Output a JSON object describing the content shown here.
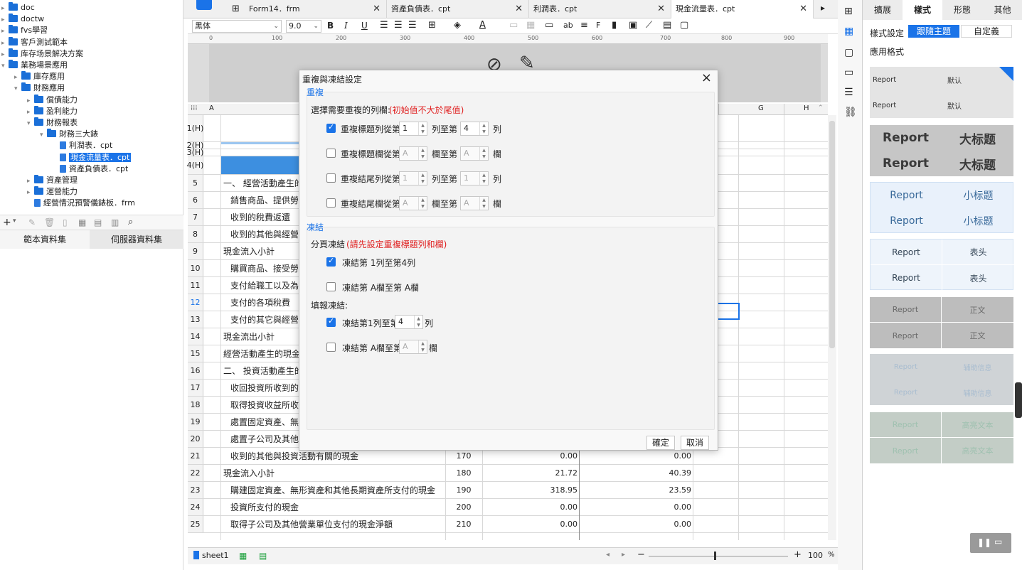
{
  "tree": [
    {
      "label": "doc",
      "type": "folder",
      "level": 0,
      "arrow": "▸"
    },
    {
      "label": "doctw",
      "type": "folder",
      "level": 0,
      "arrow": "▸"
    },
    {
      "label": "fvs學習",
      "type": "folder",
      "level": 0,
      "arrow": "▸"
    },
    {
      "label": "客戶測試範本",
      "type": "folder",
      "level": 0,
      "arrow": "▸"
    },
    {
      "label": "库存场景解决方案",
      "type": "folder",
      "level": 0,
      "arrow": "▸"
    },
    {
      "label": "業務場景應用",
      "type": "folder",
      "level": 0,
      "arrow": "▾"
    },
    {
      "label": "庫存應用",
      "type": "folder",
      "level": 1,
      "arrow": "▸"
    },
    {
      "label": "財務應用",
      "type": "folder",
      "level": 1,
      "arrow": "▾"
    },
    {
      "label": "償債能力",
      "type": "folder",
      "level": 2,
      "arrow": "▸"
    },
    {
      "label": "盈利能力",
      "type": "folder",
      "level": 2,
      "arrow": "▸"
    },
    {
      "label": "財務報表",
      "type": "folder",
      "level": 2,
      "arrow": "▾"
    },
    {
      "label": "財務三大錶",
      "type": "folder",
      "level": 3,
      "arrow": "▾"
    },
    {
      "label": "利潤表．cpt",
      "type": "file",
      "level": 4,
      "arrow": ""
    },
    {
      "label": "現金流量表．cpt",
      "type": "file",
      "level": 4,
      "arrow": "",
      "selected": true
    },
    {
      "label": "資產負債表．cpt",
      "type": "file",
      "level": 4,
      "arrow": ""
    },
    {
      "label": "資產管理",
      "type": "folder",
      "level": 2,
      "arrow": "▸"
    },
    {
      "label": "運營能力",
      "type": "folder",
      "level": 2,
      "arrow": "▸"
    },
    {
      "label": "經營情況預警儀錶板．frm",
      "type": "file",
      "level": 2,
      "arrow": ""
    }
  ],
  "left_tabs": {
    "template_ds": "範本資料集",
    "server_ds": "伺服器資料集"
  },
  "doc_tabs": [
    {
      "label": "Form14．frm"
    },
    {
      "label": "資產負債表．cpt"
    },
    {
      "label": "利潤表．cpt"
    },
    {
      "label": "現金流量表．cpt"
    }
  ],
  "format": {
    "font": "黑体",
    "size": "9.0"
  },
  "ruler": [
    "0",
    "100",
    "200",
    "300",
    "400",
    "500",
    "600",
    "700",
    "800",
    "900"
  ],
  "columns": [
    "A",
    "G",
    "H"
  ],
  "rows": [
    {
      "n": "1(H)",
      "a": "",
      "b": "",
      "c": "",
      "d": ""
    },
    {
      "n": "2(H)",
      "a": "",
      "b": "",
      "c": "",
      "d": ""
    },
    {
      "n": "3(H)",
      "a": "",
      "b": "",
      "c": "",
      "d": ""
    },
    {
      "n": "4(H)",
      "a": "",
      "b": "",
      "c": "",
      "d": ""
    },
    {
      "n": "5",
      "a": "一、 經營活動產生的",
      "b": "",
      "c": "",
      "d": ""
    },
    {
      "n": "6",
      "a": "  銷售商品、提供勞務",
      "b": "",
      "c": "",
      "d": ""
    },
    {
      "n": "7",
      "a": "  收到的稅費返還",
      "b": "",
      "c": "",
      "d": ""
    },
    {
      "n": "8",
      "a": "  收到的其他與經營",
      "b": "",
      "c": "",
      "d": ""
    },
    {
      "n": "9",
      "a": "現金流入小計",
      "b": "",
      "c": "",
      "d": ""
    },
    {
      "n": "10",
      "a": "  購買商品、接受勞務",
      "b": "",
      "c": "",
      "d": ""
    },
    {
      "n": "11",
      "a": "  支付給職工以及為職",
      "b": "",
      "c": "",
      "d": ""
    },
    {
      "n": "12",
      "a": "  支付的各項稅費",
      "b": "",
      "c": "",
      "d": ""
    },
    {
      "n": "13",
      "a": "  支付的其它與經營",
      "b": "",
      "c": "",
      "d": ""
    },
    {
      "n": "14",
      "a": "現金流出小計",
      "b": "",
      "c": "",
      "d": ""
    },
    {
      "n": "15",
      "a": "經營活動產生的現金",
      "b": "",
      "c": "",
      "d": ""
    },
    {
      "n": "16",
      "a": "二、 投資活動產生的",
      "b": "",
      "c": "",
      "d": ""
    },
    {
      "n": "17",
      "a": "  收回投資所收到的現",
      "b": "",
      "c": "",
      "d": ""
    },
    {
      "n": "18",
      "a": "  取得投資收益所收到",
      "b": "",
      "c": "",
      "d": ""
    },
    {
      "n": "19",
      "a": "  處置固定資產、無形",
      "b": "",
      "c": "",
      "d": ""
    },
    {
      "n": "20",
      "a": "  處置子公司及其他營",
      "b": "",
      "c": "",
      "d": ""
    },
    {
      "n": "21",
      "a": "  收到的其他與投資活動有關的現金",
      "b": "170",
      "c": "0.00",
      "d": "0.00"
    },
    {
      "n": "22",
      "a": "現金流入小計",
      "b": "180",
      "c": "21.72",
      "d": "40.39"
    },
    {
      "n": "23",
      "a": "  購建固定資產、無形資產和其他長期資產所支付的現金",
      "b": "190",
      "c": "318.95",
      "d": "23.59"
    },
    {
      "n": "24",
      "a": "  投資所支付的現金",
      "b": "200",
      "c": "0.00",
      "d": "0.00"
    },
    {
      "n": "25",
      "a": "  取得子公司及其他營業單位支付的現金淨額",
      "b": "210",
      "c": "0.00",
      "d": "0.00"
    }
  ],
  "sheet": {
    "name": "sheet1",
    "zoom": "100",
    "zoom_unit": "%"
  },
  "right_tabs": [
    "擴展",
    "樣式",
    "形態",
    "其他"
  ],
  "style_panel": {
    "setting_label": "樣式設定",
    "follow_theme": "跟隨主題",
    "custom": "自定義",
    "apply_format": "應用格式"
  },
  "styles": [
    {
      "l": "Report",
      "r": "默认"
    },
    {
      "l": "Report",
      "r": "大标题"
    },
    {
      "l": "Report",
      "r": "小标题"
    },
    {
      "l": "Report",
      "r": "表头"
    },
    {
      "l": "Report",
      "r": "正文"
    },
    {
      "l": "Report",
      "r": "辅助信息"
    },
    {
      "l": "Report",
      "r": "高亮文本"
    }
  ],
  "dialog": {
    "title": "重複與凍結設定",
    "repeat_section": "重複",
    "repeat_prompt": "選擇需要重複的列欄:",
    "repeat_note": "(初始值不大於尾值)",
    "repeat_rows": [
      {
        "label": "重複標題列從第",
        "from": "1",
        "mid": "列至第",
        "to": "4",
        "end": "列",
        "checked": true,
        "disabled": false
      },
      {
        "label": "重複標題欄從第",
        "from": "A",
        "mid": "欄至第",
        "to": "A",
        "end": "欄",
        "checked": false,
        "disabled": true
      },
      {
        "label": "重複結尾列從第",
        "from": "1",
        "mid": "列至第",
        "to": "1",
        "end": "列",
        "checked": false,
        "disabled": true
      },
      {
        "label": "重複結尾欄從第",
        "from": "A",
        "mid": "欄至第",
        "to": "A",
        "end": "欄",
        "checked": false,
        "disabled": true
      }
    ],
    "freeze_section": "凍結",
    "page_freeze_label": "分頁凍結",
    "page_freeze_note": "(請先設定重複標題列和欄)",
    "page_freeze_rows": [
      {
        "label": "凍結第 1列至第4列",
        "checked": true
      },
      {
        "label": "凍結第 A欄至第 A欄",
        "checked": false
      }
    ],
    "fill_freeze_label": "填報凍結:",
    "fill_row_prefix": "凍結第1列至第",
    "fill_row_value": "4",
    "fill_row_suffix": "列",
    "fill_col_prefix": "凍結第 A欄至第",
    "fill_col_value": "A",
    "fill_col_suffix": "欄",
    "ok": "確定",
    "cancel": "取消"
  }
}
